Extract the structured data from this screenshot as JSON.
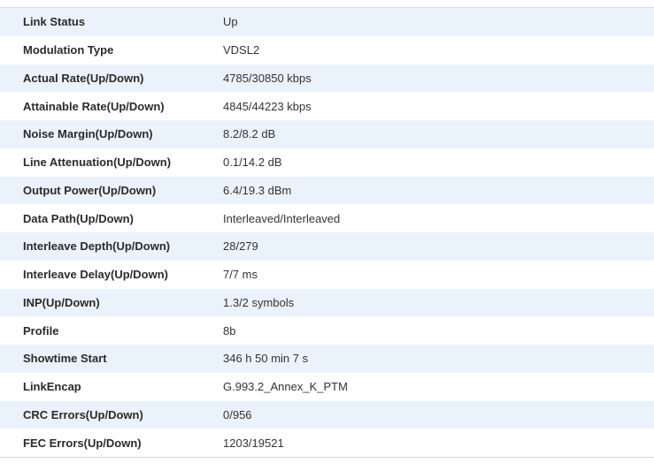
{
  "status_table": {
    "rows": [
      {
        "label": "Link Status",
        "value": "Up"
      },
      {
        "label": "Modulation Type",
        "value": "VDSL2"
      },
      {
        "label": "Actual Rate(Up/Down)",
        "value": "4785/30850 kbps"
      },
      {
        "label": "Attainable Rate(Up/Down)",
        "value": "4845/44223 kbps"
      },
      {
        "label": "Noise Margin(Up/Down)",
        "value": "8.2/8.2 dB"
      },
      {
        "label": "Line Attenuation(Up/Down)",
        "value": "0.1/14.2 dB"
      },
      {
        "label": "Output Power(Up/Down)",
        "value": "6.4/19.3 dBm"
      },
      {
        "label": "Data Path(Up/Down)",
        "value": "Interleaved/Interleaved"
      },
      {
        "label": "Interleave Depth(Up/Down)",
        "value": "28/279"
      },
      {
        "label": "Interleave Delay(Up/Down)",
        "value": "7/7 ms"
      },
      {
        "label": "INP(Up/Down)",
        "value": "1.3/2 symbols"
      },
      {
        "label": "Profile",
        "value": "8b"
      },
      {
        "label": "Showtime Start",
        "value": "346 h 50 min 7 s"
      },
      {
        "label": "LinkEncap",
        "value": "G.993.2_Annex_K_PTM"
      },
      {
        "label": "CRC Errors(Up/Down)",
        "value": "0/956"
      },
      {
        "label": "FEC Errors(Up/Down)",
        "value": "1203/19521"
      }
    ]
  },
  "colors": {
    "row_alt": "#eaf3fb",
    "row_base": "#ffffff",
    "label_text": "#2b2b2b",
    "value_text": "#333333",
    "border": "#d9d9d9"
  }
}
